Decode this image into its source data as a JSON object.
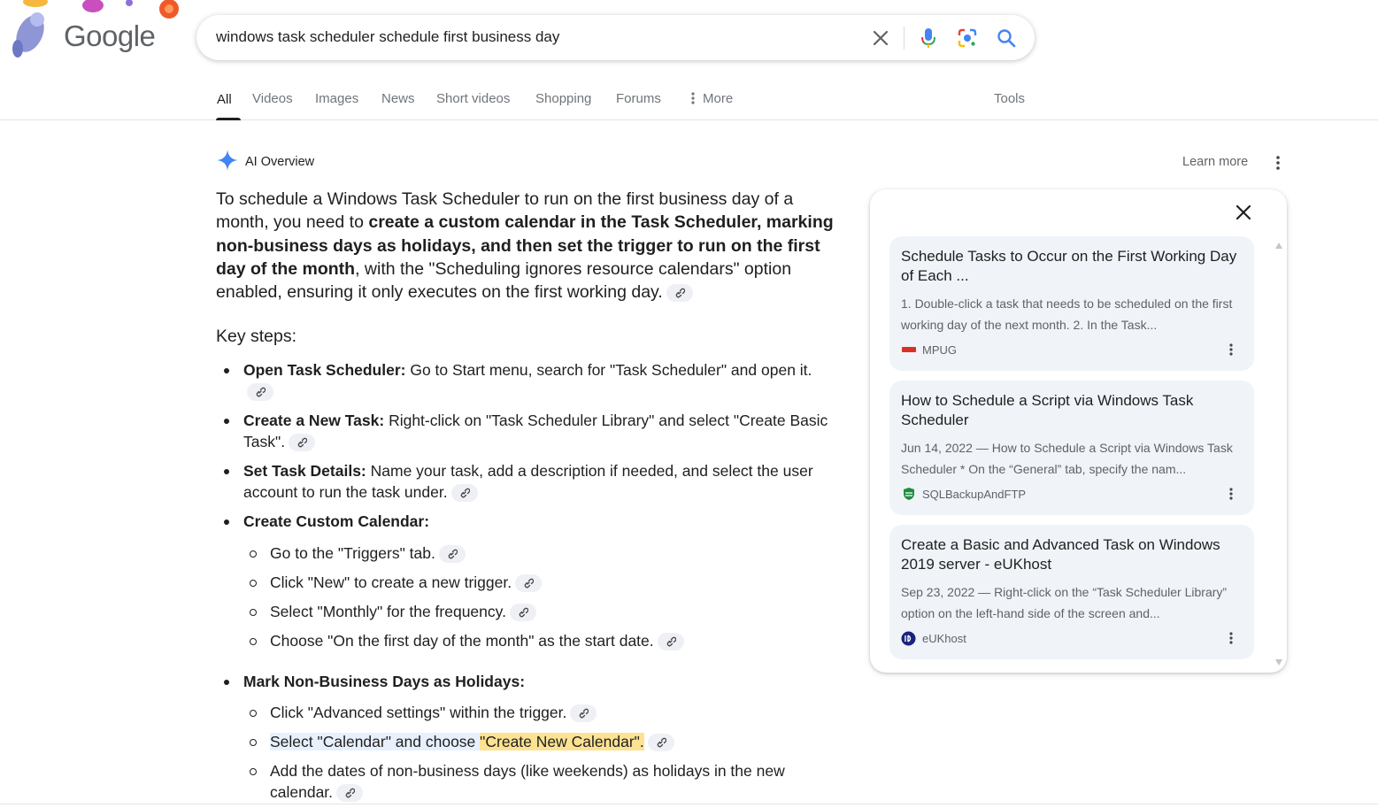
{
  "header": {
    "logo": "Google",
    "search": {
      "value": "windows task scheduler schedule first business day",
      "icons": [
        "close-icon",
        "microphone-icon",
        "lens-icon",
        "search-icon"
      ]
    },
    "tabs": [
      {
        "label": "All",
        "active": true
      },
      {
        "label": "Videos"
      },
      {
        "label": "Images"
      },
      {
        "label": "News"
      },
      {
        "label": "Short videos"
      },
      {
        "label": "Shopping"
      },
      {
        "label": "Forums"
      },
      {
        "label": "More"
      }
    ],
    "tools": "Tools"
  },
  "ai_overview": {
    "label": "AI Overview",
    "learn_more": "Learn more",
    "intro": {
      "part1": "To schedule a Windows Task Scheduler to run on the first business day of a month, you need to ",
      "bold": "create a custom calendar in the Task Scheduler, marking non-business days as holidays, and then set the trigger to run on the first day of the month",
      "part2": ", with the \"Scheduling ignores resource calendars\" option enabled, ensuring it only executes on the first working day."
    },
    "key_steps_heading": "Key steps:",
    "steps": [
      {
        "bold": "Open Task Scheduler:",
        "text": " Go to Start menu, search for \"Task Scheduler\" and open it."
      },
      {
        "bold": "Create a New Task:",
        "text": " Right-click on \"Task Scheduler Library\" and select \"Create Basic Task\"."
      },
      {
        "bold": "Set Task Details:",
        "text": " Name your task, add a description if needed, and select the user account to run the task under."
      },
      {
        "bold": "Create Custom Calendar:",
        "text": ""
      }
    ],
    "calendar_substeps": [
      "Go to the \"Triggers\" tab.",
      "Click \"New\" to create a new trigger.",
      "Select \"Monthly\" for the frequency.",
      "Choose \"On the first day of the month\" as the start date."
    ],
    "holidays_step": {
      "bold": "Mark Non-Business Days as Holidays:"
    },
    "holiday_substeps": {
      "a": "Click \"Advanced settings\" within the trigger.",
      "b_part1": "Select \"Calendar\" and choose ",
      "b_part2": "\"Create New Calendar\".",
      "c": "Add the dates of non-business days (like weekends) as holidays in the new calendar."
    }
  },
  "sources": [
    {
      "title": "Schedule Tasks to Occur on the First Working Day of Each ...",
      "snippet": "1. Double-click a task that needs to be scheduled on the first working day of the next month. 2. In the Task...",
      "site": "MPUG",
      "favicon_color": "#d93025"
    },
    {
      "title": "How to Schedule a Script via Windows Task Scheduler",
      "snippet": "Jun 14, 2022 — How to Schedule a Script via Windows Task Scheduler * On the “General” tab, specify the nam...",
      "site": "SQLBackupAndFTP",
      "favicon_color": "#1e8e3e"
    },
    {
      "title": "Create a Basic and Advanced Task on Windows 2019 server - eUKhost",
      "snippet": "Sep 23, 2022 — Right-click on the “Task Scheduler Library” option on the left-hand side of the screen and...",
      "site": "eUKhost",
      "favicon_color": "#1a237e"
    }
  ],
  "colors": {
    "accent_blue": "#1a73e8",
    "highlight": "#fde293",
    "card_bg": "#f0f4f9"
  }
}
